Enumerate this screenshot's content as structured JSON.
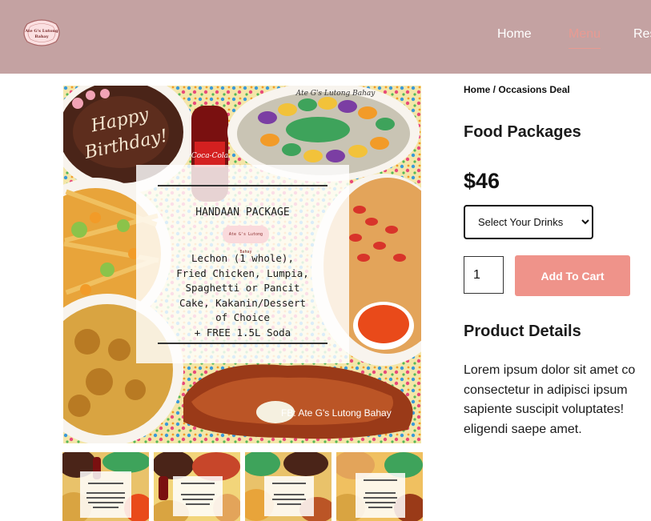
{
  "header": {
    "logo_text": "Ate G's Lutong Bahay",
    "nav": [
      {
        "label": "Home"
      },
      {
        "label": "Menu"
      },
      {
        "label": "Res"
      }
    ]
  },
  "product_image": {
    "package_title": "HANDAAN PACKAGE",
    "logo_text": "Ate G's Lutong Bahay",
    "lines": [
      "Lechon (1 whole),",
      "Fried Chicken, Lumpia,",
      "Spaghetti or Pancit",
      "Cake, Kakanin/Dessert",
      "of Choice",
      "+ FREE 1.5L Soda"
    ],
    "watermark": "FB: Ate G's Lutong Bahay"
  },
  "breadcrumb": {
    "home": "Home",
    "separator": " / ",
    "current": "Occasions Deal"
  },
  "product": {
    "title": "Food Packages",
    "price": "$46",
    "drinks_select": {
      "selected": "Select Your Drinks"
    },
    "quantity": "1",
    "add_to_cart": "Add To Cart",
    "details_heading": "Product Details",
    "details_lines": [
      "Lorem ipsum dolor sit amet co",
      "consectetur in adipisci ipsum",
      "sapiente suscipit voluptates!",
      "eligendi saepe amet."
    ]
  },
  "colors": {
    "header_bg": "#c4a2a2",
    "accent": "#ef938a"
  }
}
